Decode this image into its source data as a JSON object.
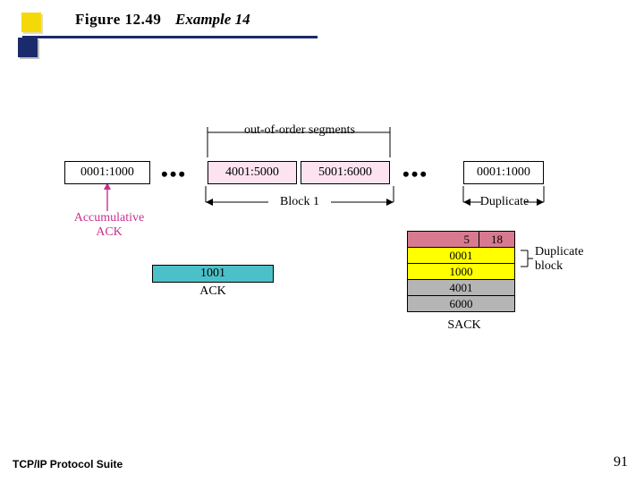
{
  "header": {
    "figure_number": "Figure 12.49",
    "title": "Example 14"
  },
  "footer": {
    "book": "TCP/IP Protocol Suite",
    "page": "91"
  },
  "labels": {
    "out_of_order": "out-of-order  segments",
    "block1": "Block 1",
    "duplicate": "Duplicate",
    "accum_ack1": "Accumulative",
    "accum_ack2": "ACK",
    "ack_value": "1001",
    "ack_label": "ACK",
    "sack_label": "SACK",
    "dup_block1": "Duplicate",
    "dup_block2": "block"
  },
  "segments": {
    "s1": "0001:1000",
    "s2": "4001:5000",
    "s3": "5001:6000",
    "s4": "0001:1000"
  },
  "sack_table": {
    "header_left": "5",
    "header_right": "18",
    "rows": [
      "0001",
      "1000",
      "4001",
      "6000"
    ]
  }
}
